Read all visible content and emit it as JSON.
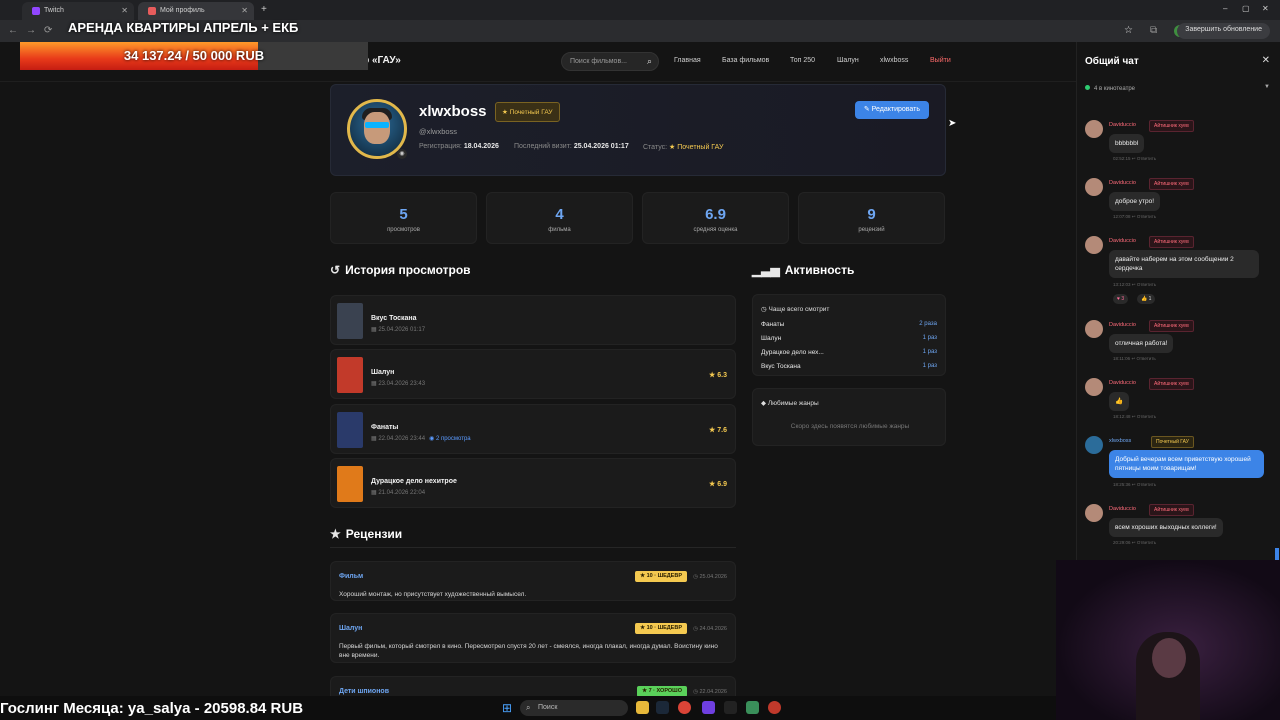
{
  "browser": {
    "tabs": [
      {
        "label": "Twitch",
        "color": "#9146ff"
      },
      {
        "label": "Мой профиль",
        "color": "#e85c5c"
      }
    ],
    "update_label": "Завершить обновление",
    "profile_letter": "Y"
  },
  "overlay": {
    "title": "АРЕНДА КВАРТИРЫ АПРЕЛЬ + ЕКБ",
    "donation_text": "34 137.24 / 50 000 RUB",
    "donation_progress": 0.683,
    "ticker": "Гослинг Месяца: ya_salya - 20598.84 RUB"
  },
  "nav": {
    "brand": "Кинотеатр «ГАУ»",
    "search_placeholder": "Поиск фильмов...",
    "links": [
      "Главная",
      "База фильмов",
      "Топ 250",
      "Шалун",
      "xlwxboss"
    ],
    "exit": "Выйти"
  },
  "profile": {
    "username": "xlwxboss",
    "badge": "Почетный ГАУ",
    "handle": "@xlwxboss",
    "reg_label": "Регистрация:",
    "reg_date": "18.04.2026",
    "last_label": "Последний визит:",
    "last_date": "25.04.2026 01:17",
    "status_label": "Статус:",
    "status": "Почетный ГАУ",
    "edit_label": "Редактировать"
  },
  "stats": [
    {
      "value": "5",
      "label": "просмотров"
    },
    {
      "value": "4",
      "label": "фильма"
    },
    {
      "value": "6.9",
      "label": "средняя оценка"
    },
    {
      "value": "9",
      "label": "рецензий"
    }
  ],
  "history": {
    "title": "История просмотров",
    "items": [
      {
        "title": "Вкус Тоскана",
        "date": "25.04.2026 01:17",
        "rating": "",
        "views": "",
        "poster": "#3a4250"
      },
      {
        "title": "Шалун",
        "date": "23.04.2026 23:43",
        "rating": "6.3",
        "views": "",
        "poster": "#c23a2a"
      },
      {
        "title": "Фанаты",
        "date": "22.04.2026 23:44",
        "rating": "7.6",
        "views": "2 просмотра",
        "poster": "#2a3a6a"
      },
      {
        "title": "Дурацкое дело нехитрое",
        "date": "21.04.2026 22:04",
        "rating": "6.9",
        "views": "",
        "poster": "#e07a1a"
      }
    ]
  },
  "activity": {
    "title": "Активность",
    "most_watched_title": "Чаще всего смотрит",
    "most_watched": [
      {
        "name": "Фанаты",
        "count": "2 раза"
      },
      {
        "name": "Шалун",
        "count": "1 раз"
      },
      {
        "name": "Дурацкое дело нех...",
        "count": "1 раз"
      },
      {
        "name": "Вкус Тоскана",
        "count": "1 раз"
      }
    ],
    "genres_title": "Любимые жанры",
    "genres_empty": "Скоро здесь появятся любимые жанры"
  },
  "reviews": {
    "title": "Рецензии",
    "items": [
      {
        "movie": "Фильм",
        "badge": "10 · ШЕДЕВР",
        "badge_color": "#f4c950",
        "date": "25.04.2026",
        "text": "Хороший монтаж, но присутствует художественный вымысел."
      },
      {
        "movie": "Шалун",
        "badge": "10 · ШЕДЕВР",
        "badge_color": "#f4c950",
        "date": "24.04.2026",
        "text": "Первый фильм, который смотрел в кино. Пересмотрел спустя 20 лет - смеялся, иногда плакал, иногда думал. Воистину кино вне времени."
      },
      {
        "movie": "Дети шпионов",
        "badge": "7 · ХОРОШО",
        "badge_color": "#5ad15a",
        "date": "22.04.2026",
        "text": ""
      }
    ]
  },
  "chat": {
    "title": "Общий чат",
    "online": "4 в кинотеатре",
    "reply_label": "Ответить",
    "messages": [
      {
        "name": "Daviduccio",
        "tag": "Айтишник хуев",
        "text": "bbbbbbl",
        "time": "02:52:15",
        "me": false
      },
      {
        "name": "Daviduccio",
        "tag": "Айтишник хуев",
        "text": "доброе утро!",
        "time": "12:07:08",
        "me": false
      },
      {
        "name": "Daviduccio",
        "tag": "Айтишник хуев",
        "text": "давайте наберем на этом сообщении 2 сердечка",
        "time": "13:12:03",
        "me": false,
        "reactions": [
          "♥ 3",
          "👍 1"
        ]
      },
      {
        "name": "Daviduccio",
        "tag": "Айтишник хуев",
        "text": "отличная работа!",
        "time": "18:11:06",
        "me": false
      },
      {
        "name": "Daviduccio",
        "tag": "Айтишник хуев",
        "text": "👍",
        "time": "18:12:48",
        "me": false
      },
      {
        "name": "xlwxboss",
        "tag": "Почетный ГАУ",
        "text": "Добрый вечерам всем приветствую хорошей пятницы моим товарищам!",
        "time": "18:25:36",
        "me": true
      },
      {
        "name": "Daviduccio",
        "tag": "Айтишник хуев",
        "text": "всем хороших выходных коллеги!",
        "time": "20:29:06",
        "me": false
      }
    ]
  },
  "taskbar": {
    "search": "Поиск"
  }
}
